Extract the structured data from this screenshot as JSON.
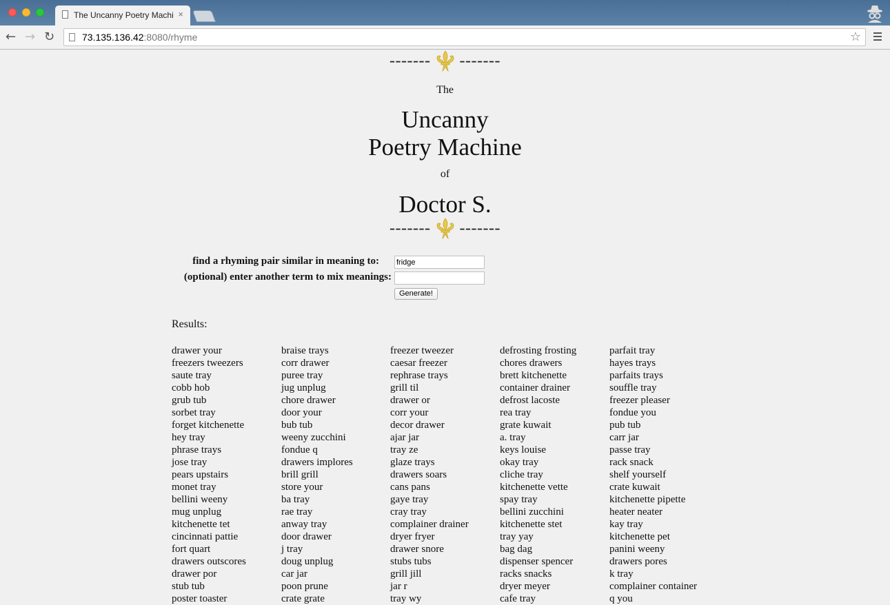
{
  "browser": {
    "tab_title": "The Uncanny Poetry Machi",
    "tab_close": "×",
    "url_host": "73.135.136.42",
    "url_rest": ":8080/rhyme"
  },
  "page": {
    "divider_left": "-------",
    "divider_right": "-------",
    "the": "The",
    "title_line1": "Uncanny",
    "title_line2": "Poetry Machine",
    "of": "of",
    "author": "Doctor S.",
    "form": {
      "label1": "find a rhyming pair similar in meaning to:",
      "value1": "fridge",
      "label2": "(optional) enter another term to mix meanings:",
      "value2": "",
      "generate_label": "Generate!"
    },
    "results_label": "Results:",
    "columns": [
      [
        "drawer your",
        "freezers tweezers",
        "saute tray",
        "cobb hob",
        "grub tub",
        "sorbet tray",
        "forget kitchenette",
        "hey tray",
        "phrase trays",
        "jose tray",
        "pears upstairs",
        "monet tray",
        "bellini weeny",
        "mug unplug",
        "kitchenette tet",
        "cincinnati pattie",
        "fort quart",
        "drawers outscores",
        "drawer por",
        "stub tub",
        "poster toaster"
      ],
      [
        "braise trays",
        "corr drawer",
        "puree tray",
        "jug unplug",
        "chore drawer",
        "door your",
        "bub tub",
        "weeny zucchini",
        "fondue q",
        "drawers implores",
        "brill grill",
        "store your",
        "ba tray",
        "rae tray",
        "anway tray",
        "door drawer",
        "j tray",
        "doug unplug",
        "car jar",
        "poon prune",
        "crate grate"
      ],
      [
        "freezer tweezer",
        "caesar freezer",
        "rephrase trays",
        "grill til",
        "drawer or",
        "corr your",
        "decor drawer",
        "ajar jar",
        "tray ze",
        "glaze trays",
        "drawers soars",
        "cans pans",
        "gaye tray",
        "cray tray",
        "complainer drainer",
        "dryer fryer",
        "drawer snore",
        "stubs tubs",
        "grill jill",
        "jar r",
        "tray wy"
      ],
      [
        "defrosting frosting",
        "chores drawers",
        "brett kitchenette",
        "container drainer",
        "defrost lacoste",
        "rea tray",
        "grate kuwait",
        "a. tray",
        "keys louise",
        "okay tray",
        "cliche tray",
        "kitchenette vette",
        "spay tray",
        "bellini zucchini",
        "kitchenette stet",
        "tray yay",
        "bag dag",
        "dispenser spencer",
        "racks snacks",
        "dryer meyer",
        "cafe tray"
      ],
      [
        "parfait tray",
        "hayes trays",
        "parfaits trays",
        "souffle tray",
        "freezer pleaser",
        "fondue you",
        "pub tub",
        "carr jar",
        "passe tray",
        "rack snack",
        "shelf yourself",
        "crate kuwait",
        "kitchenette pipette",
        "heater neater",
        "kay tray",
        "kitchenette pet",
        "panini weeny",
        "drawers pores",
        "k tray",
        "complainer container",
        "q you"
      ]
    ]
  }
}
